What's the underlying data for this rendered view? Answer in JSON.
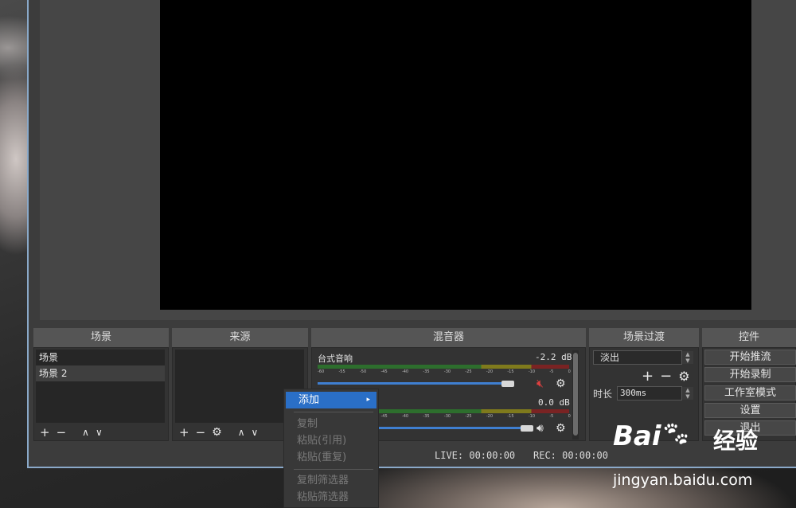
{
  "docks": {
    "scenes_title": "场景",
    "sources_title": "来源",
    "mixer_title": "混音器",
    "transition_title": "场景过渡",
    "controls_title": "控件"
  },
  "scenes": {
    "items": [
      "场景",
      "场景 2"
    ],
    "selected_index": 1
  },
  "toolbar_icons": {
    "add": "+",
    "remove": "−",
    "up": "∧",
    "down": "∨",
    "gear": "⚙"
  },
  "mixer": {
    "tracks": [
      {
        "name": "台式音响",
        "db": "-2.2 dB",
        "muted": true,
        "volume": 0.87
      },
      {
        "name": "",
        "db": "0.0 dB",
        "muted": false,
        "volume": 1.0
      }
    ],
    "ticks": [
      "-60",
      "-55",
      "-50",
      "-45",
      "-40",
      "-35",
      "-30",
      "-25",
      "-20",
      "-15",
      "-10",
      "-5",
      "0"
    ]
  },
  "transition": {
    "selected": "淡出",
    "duration_label": "时长",
    "duration_value": "300ms"
  },
  "controls": {
    "start_stream": "开始推流",
    "start_record": "开始录制",
    "studio_mode": "工作室模式",
    "settings": "设置",
    "exit": "退出"
  },
  "status": {
    "live": "LIVE: 00:00:00",
    "rec": "REC: 00:00:00"
  },
  "context_menu": {
    "add": "添加",
    "copy": "复制",
    "paste_ref": "粘贴(引用)",
    "paste_dup": "粘贴(重复)",
    "copy_filters": "复制筛选器",
    "paste_filters": "粘贴筛选器"
  },
  "watermark": {
    "logo": "Bai",
    "brand_cn": "经验",
    "url": "jingyan.baidu.com"
  },
  "colors": {
    "accent": "#2a6fc7",
    "slider": "#3f7fd1",
    "muted_icon": "#e04040"
  }
}
